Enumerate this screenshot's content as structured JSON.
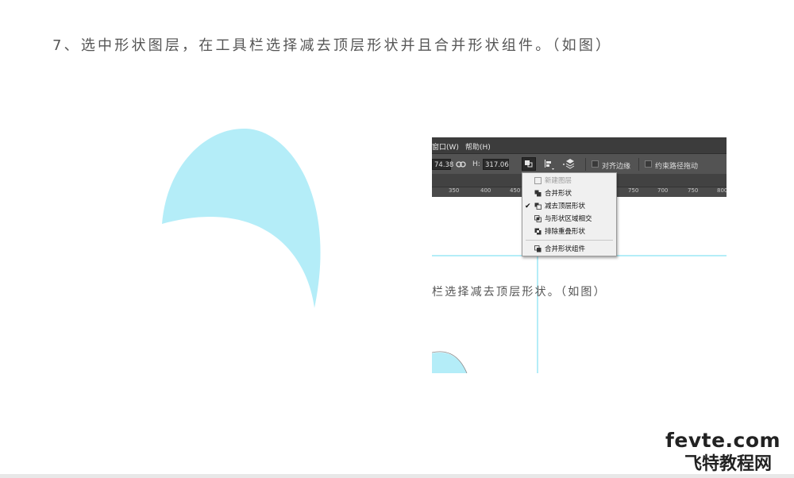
{
  "instruction": "7、选中形状图层，在工具栏选择减去顶层形状并且合并形状组件。（如图）",
  "colors": {
    "shape": "#b4edf8",
    "text": "#555555",
    "menubar": "#3c3c3c",
    "optionsbar": "#535353"
  },
  "photoshop": {
    "menu": {
      "window": "窗口(W)",
      "help": "帮助(H)"
    },
    "options": {
      "w_value": "74.38",
      "h_label": "H:",
      "h_value": "317.06",
      "align_edges": "对齐边缘",
      "constrain_path": "约束路径拖动"
    },
    "ruler_ticks": [
      "350",
      "400",
      "450",
      "750",
      "700",
      "750",
      "800"
    ],
    "caption": "栏选择减去顶层形状。（如图）",
    "dropdown": {
      "items": [
        {
          "label": "新建图层",
          "icon": "new-layer-icon",
          "disabled": true
        },
        {
          "label": "合并形状",
          "icon": "combine-shapes-icon"
        },
        {
          "label": "减去顶层形状",
          "icon": "subtract-front-shape-icon",
          "checked": true
        },
        {
          "label": "与形状区域相交",
          "icon": "intersect-shape-areas-icon"
        },
        {
          "label": "排除重叠形状",
          "icon": "exclude-overlapping-icon"
        },
        {
          "label": "合并形状组件",
          "icon": "merge-shape-components-icon"
        }
      ]
    }
  },
  "watermark": {
    "site": "fevte.com",
    "name": "飞特教程网"
  }
}
